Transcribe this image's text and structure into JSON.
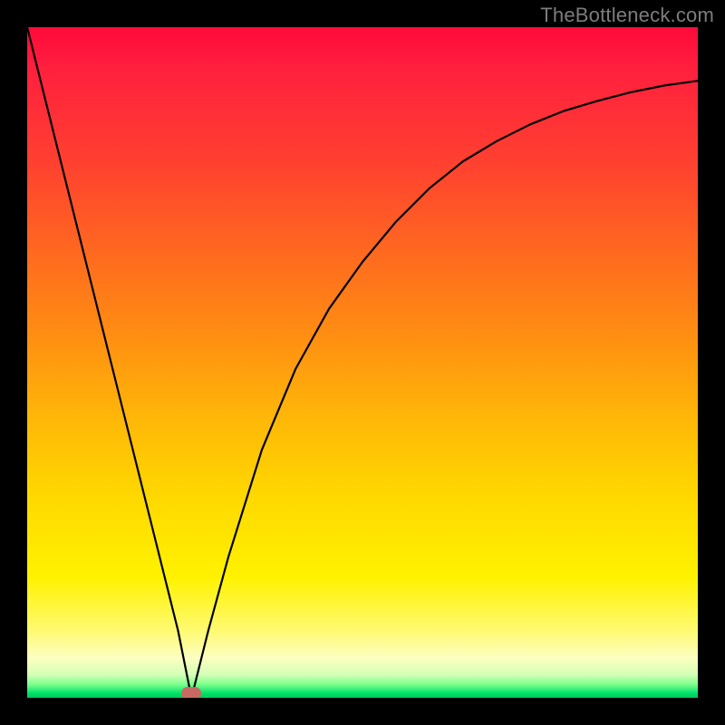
{
  "watermark": "TheBottleneck.com",
  "marker": {
    "x_frac": 0.245,
    "y_frac": 0.993
  },
  "chart_data": {
    "type": "line",
    "title": "",
    "xlabel": "",
    "ylabel": "",
    "xlim": [
      0,
      1
    ],
    "ylim": [
      0,
      1
    ],
    "background": "red-yellow-green vertical gradient (bottleneck heatmap)",
    "series": [
      {
        "name": "left-branch",
        "x": [
          0.0,
          0.05,
          0.1,
          0.15,
          0.2,
          0.225,
          0.245
        ],
        "y": [
          1.0,
          0.8,
          0.6,
          0.4,
          0.2,
          0.1,
          0.0
        ]
      },
      {
        "name": "right-branch",
        "x": [
          0.245,
          0.27,
          0.3,
          0.35,
          0.4,
          0.45,
          0.5,
          0.55,
          0.6,
          0.65,
          0.7,
          0.75,
          0.8,
          0.85,
          0.9,
          0.95,
          1.0
        ],
        "y": [
          0.0,
          0.1,
          0.21,
          0.37,
          0.49,
          0.58,
          0.65,
          0.71,
          0.76,
          0.8,
          0.83,
          0.855,
          0.875,
          0.89,
          0.903,
          0.913,
          0.92
        ]
      }
    ],
    "marker": {
      "x": 0.245,
      "y": 0.0,
      "color": "#c76a63",
      "shape": "rounded-rect"
    },
    "notes": "x and y are fractions of the plotting area; y=0 at bottom, y=1 at top (no numeric axes are drawn in the image)."
  }
}
